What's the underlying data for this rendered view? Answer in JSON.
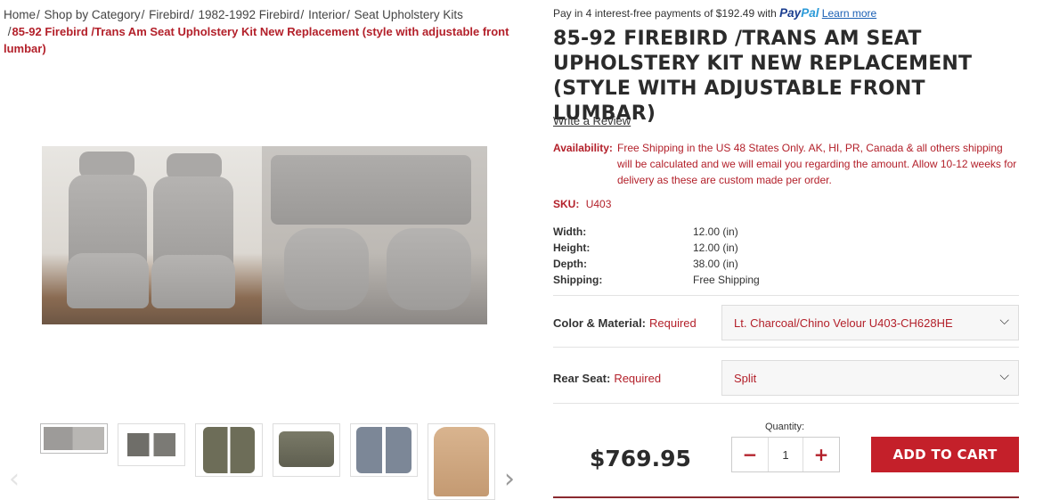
{
  "breadcrumb": {
    "items": [
      "Home",
      "Shop by Category",
      "Firebird",
      "1982-1992 Firebird",
      "Interior",
      "Seat Upholstery Kits"
    ],
    "current": "85-92 Firebird /Trans Am Seat Upholstery Kit New Replacement (style with adjustable front lumbar)"
  },
  "paypal": {
    "text": "Pay in 4 interest-free payments of $192.49 with",
    "logo_a": "Pay",
    "logo_b": "Pal",
    "link": "Learn more"
  },
  "product": {
    "title": "85-92 FIREBIRD /TRANS AM SEAT UPHOLSTERY KIT NEW REPLACEMENT (STYLE WITH ADJUSTABLE FRONT LUMBAR)",
    "review_link": "Write a Review",
    "availability_label": "Availability:",
    "availability_text": "Free Shipping in the US 48 States Only. AK, HI, PR, Canada & all others shipping will be calculated and we will email you regarding the amount. Allow 10-12 weeks for delivery as these are custom made per order.",
    "sku_label": "SKU:",
    "sku_value": "U403",
    "specs": [
      {
        "label": "Width:",
        "value": "12.00 (in)"
      },
      {
        "label": "Height:",
        "value": "12.00 (in)"
      },
      {
        "label": "Depth:",
        "value": "38.00 (in)"
      },
      {
        "label": "Shipping:",
        "value": "Free Shipping"
      }
    ],
    "price": "$769.95"
  },
  "options": {
    "color": {
      "label": "Color & Material:",
      "required": "Required",
      "value": "Lt. Charcoal/Chino Velour U403-CH628HE"
    },
    "rear": {
      "label": "Rear Seat:",
      "required": "Required",
      "value": "Split"
    }
  },
  "quantity": {
    "label": "Quantity:",
    "value": "1",
    "minus": "−",
    "plus": "+"
  },
  "cart": {
    "label": "ADD TO CART"
  },
  "icons": {
    "prev": "chevron-left-icon",
    "next": "chevron-right-icon",
    "dropdown": "chevron-down-icon"
  },
  "colors": {
    "accent": "#b3202a",
    "button": "#c4202a",
    "paypal_dark": "#1a3d8f",
    "paypal_light": "#2a9ad8"
  }
}
